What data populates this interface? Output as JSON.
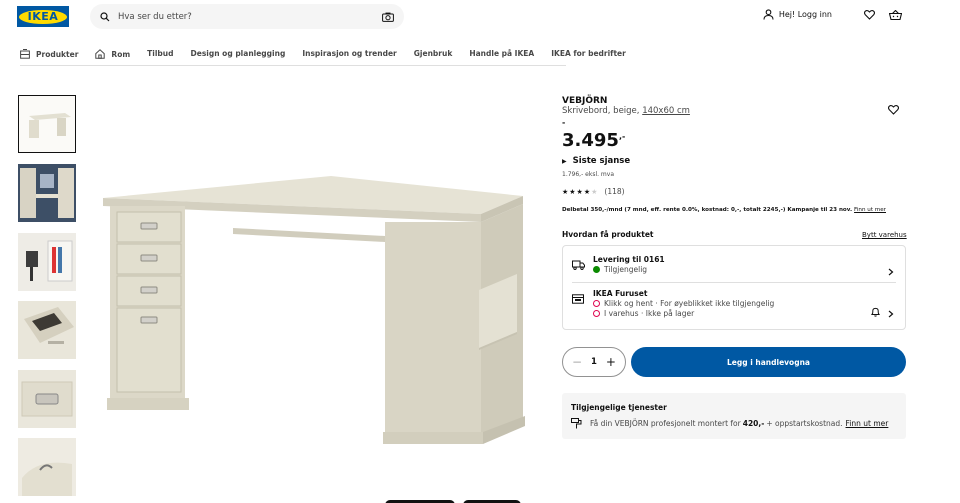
{
  "header": {
    "logo_text": "IKEA",
    "search_placeholder": "Hva ser du etter?",
    "login_label": "Hej! Logg inn"
  },
  "nav": [
    "Produkter",
    "Rom",
    "Tilbud",
    "Design og planlegging",
    "Inspirasjon og trender",
    "Gjenbruk",
    "Handle på IKEA",
    "IKEA for bedrifter"
  ],
  "product": {
    "name": "VEBJÖRN",
    "description": "Skrivebord, beige,",
    "size": "140x60 cm",
    "dash": "-",
    "price": "3.495",
    "price_suffix": ",-",
    "last_chance": "Siste sjanse",
    "ex_vat": "1.796,- eksl. mva",
    "review_count": "(118)",
    "rating": 3.5,
    "installment": "Delbetal 350,-/mnd (7 mnd, eff. rente 0.0%, kostnad: 0,-, totalt 2245,-) Kampanje til 23 nov.",
    "installment_link": "Finn ut mer"
  },
  "fulfilment": {
    "heading": "Hvordan få produktet",
    "change_store": "Bytt varehus",
    "delivery_title": "Levering til 0161",
    "delivery_status": "Tilgjengelig",
    "store_title": "IKEA Furuset",
    "click_collect": "Klikk og hent · For øyeblikket ikke tilgjengelig",
    "in_store": "I varehus · Ikke på lager"
  },
  "cart": {
    "quantity": "1",
    "minus": "−",
    "plus": "+",
    "add_label": "Legg i handlevogna"
  },
  "services": {
    "title": "Tilgjengelige tjenester",
    "text_pre": "Få din VEBJÖRN profesjonelt montert for",
    "price": "420,-",
    "text_post": "+ oppstartskostnad.",
    "link": "Finn ut mer"
  },
  "colors": {
    "brand_blue": "#0058a3",
    "brand_yellow": "#ffdb00",
    "available_green": "#0a8a00",
    "unavailable_red": "#e00751"
  }
}
